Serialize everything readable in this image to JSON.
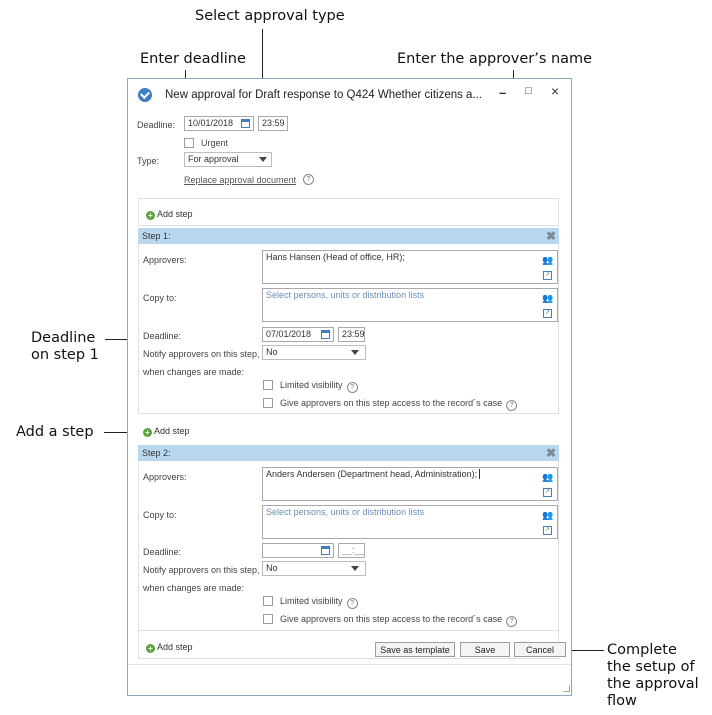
{
  "callouts": {
    "select_type": "Select approval type",
    "enter_deadline": "Enter deadline",
    "enter_approver": "Enter the approver’s name",
    "deadline_step1_l1": "Deadline",
    "deadline_step1_l2": "on step 1",
    "add_step": "Add a step",
    "complete_l1": "Complete",
    "complete_l2": "the setup of",
    "complete_l3": "the approval",
    "complete_l4": "flow"
  },
  "window": {
    "title": "New approval for Draft response to Q424 Whether citizens a...",
    "minimize": "–",
    "maximize": "□",
    "close": "×"
  },
  "header": {
    "deadline_label": "Deadline:",
    "deadline_date": "10/01/2018",
    "deadline_time": "23:59",
    "urgent_label": "Urgent",
    "type_label": "Type:",
    "type_value": "For approval",
    "replace_link": "Replace approval document",
    "help": "?"
  },
  "add_step_label": "Add step",
  "steps": [
    {
      "title": "Step 1:",
      "approvers_label": "Approvers:",
      "approvers_value": "Hans Hansen (Head of office, HR);",
      "copy_label": "Copy to:",
      "copy_placeholder": "Select persons, units or distribution lists",
      "deadline_label": "Deadline:",
      "deadline_date": "07/01/2018",
      "deadline_time": "23:59",
      "notify_label_l1": "Notify approvers on this step,",
      "notify_label_l2": "when changes are made:",
      "notify_value": "No",
      "limited_label": "Limited visibility",
      "access_label": "Give approvers on this step access to the record´s case"
    },
    {
      "title": "Step 2:",
      "approvers_label": "Approvers:",
      "approvers_value": "Anders Andersen (Department head, Administration);",
      "copy_label": "Copy to:",
      "copy_placeholder": "Select persons, units or distribution lists",
      "deadline_label": "Deadline:",
      "deadline_date": "",
      "deadline_time": "__:__",
      "notify_label_l1": "Notify approvers on this step,",
      "notify_label_l2": "when changes are made:",
      "notify_value": "No",
      "limited_label": "Limited visibility",
      "access_label": "Give approvers on this step access to the record´s case"
    }
  ],
  "footer": {
    "save_template": "Save as template",
    "save": "Save",
    "cancel": "Cancel"
  },
  "colors": {
    "step_header": "#b9d7ef",
    "add_icon": "#5aa33e",
    "app_icon": "#3d7fc1"
  },
  "icons": [
    "app-logo-icon",
    "calendar-icon",
    "dropdown-arrow-icon",
    "help-icon",
    "add-icon",
    "remove-step-icon",
    "people-picker-icon",
    "open-icon"
  ]
}
